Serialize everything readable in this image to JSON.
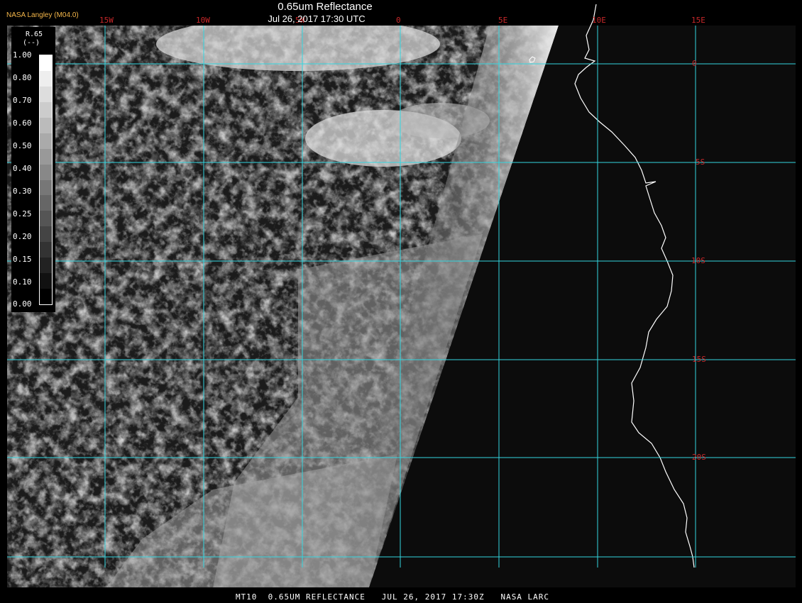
{
  "header": {
    "title": "0.65um Reflectance",
    "subtitle": "Jul 26, 2017 17:30 UTC",
    "brand": "NASA Langley (M04.0)"
  },
  "legend": {
    "variable": "R.65",
    "unit": "(--)",
    "ticks": [
      "1.00",
      "0.80",
      "0.70",
      "0.60",
      "0.50",
      "0.40",
      "0.30",
      "0.25",
      "0.20",
      "0.15",
      "0.10",
      "0.00"
    ],
    "colors": [
      "#ffffff",
      "#eeeeee",
      "#dddddd",
      "#cccccc",
      "#bbbbbb",
      "#aaaaaa",
      "#999999",
      "#888888",
      "#777777",
      "#666666",
      "#555555",
      "#444444",
      "#333333",
      "#222222",
      "#111111",
      "#000000"
    ]
  },
  "grid": {
    "longitudes": [
      "15W",
      "10W",
      "5W",
      "0",
      "5E",
      "10E",
      "15E"
    ],
    "latitudes": [
      "0",
      "5S",
      "10S",
      "15S",
      "20S"
    ],
    "color": "#33d6e0",
    "label_color": "#c8282a"
  },
  "imagery": {
    "background": "#0c0c0c",
    "coastline_color": "#ffffff"
  },
  "footer": {
    "caption": "MT10  0.65UM REFLECTANCE   JUL 26, 2017 17:30Z   NASA LARC"
  }
}
